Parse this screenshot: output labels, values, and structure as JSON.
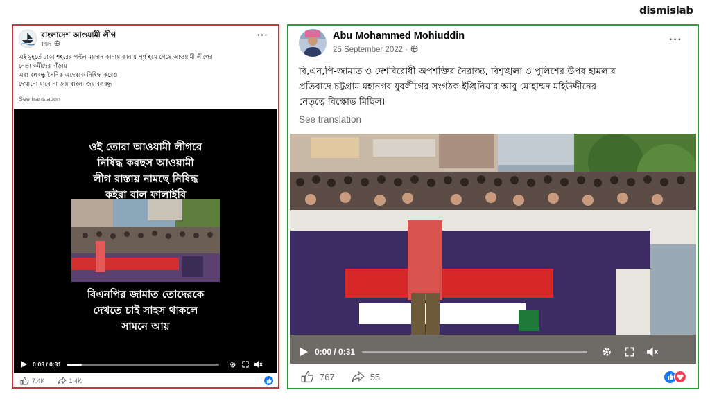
{
  "brand": {
    "logo_text": "dismislab"
  },
  "left_post": {
    "author": "বাংলাদেশ আওয়ামী লীগ",
    "time": "19h",
    "menu": "···",
    "caption_lines": [
      "এই মুহূর্তে ঢাকা শহরের পল্টন ময়দান কানায় কানায় পূর্ণ হয়ে গেছে আওয়ামী লীগের",
      "নেতা কর্মীদের দাঁড়ায়",
      "এরা বঙ্গবন্ধু সৈনিক এদেরকে নিষিদ্ধ করেও",
      "দেখানো যাবে না জয় বাংলা জয় বঙ্গবন্ধু"
    ],
    "see_translation": "See translation",
    "video": {
      "overlay_top_lines": [
        "ওই তোরা আওয়ামী লীগরে",
        "নিষিদ্ধ করছস আওয়ামী",
        "লীগ রাস্তায় নামছে নিষিদ্ধ",
        "কইরা বাল ফালাইবি"
      ],
      "overlay_bottom_lines": [
        "বিএনপির জামাত তোদেরকে",
        "দেখতে চাই সাহস থাকলে",
        "সামনে আয়"
      ],
      "time_display": "0:03 / 0:31",
      "progress": 0.1
    },
    "reactions": {
      "likes": "7.4K",
      "shares": "1.4K"
    }
  },
  "right_post": {
    "author": "Abu Mohammed Mohiuddin",
    "date": "25 September 2022 ·",
    "menu": "···",
    "caption_lines": [
      "বি,এন,পি-জামাত ও দেশবিরোধী অপশক্তির নৈরাজ্য, বিশৃঙ্খলা ও পুলিশের উপর হামলার",
      "প্রতিবাদে চট্টগ্রাম মহানগর যুবলীগের সংগঠক ইঞ্জিনিয়ার আবু মোহাম্মদ মহিউদ্দীনের",
      "নেতৃত্বে বিক্ষোভ মিছিল।"
    ],
    "see_translation": "See translation",
    "video": {
      "time_display": "0:00 / 0:31",
      "progress": 0.0
    },
    "reactions": {
      "likes": "767",
      "shares": "55"
    }
  },
  "colors": {
    "left_border": "#c0393b",
    "right_border": "#2e9a3e",
    "facebook_blue": "#1877f2"
  }
}
